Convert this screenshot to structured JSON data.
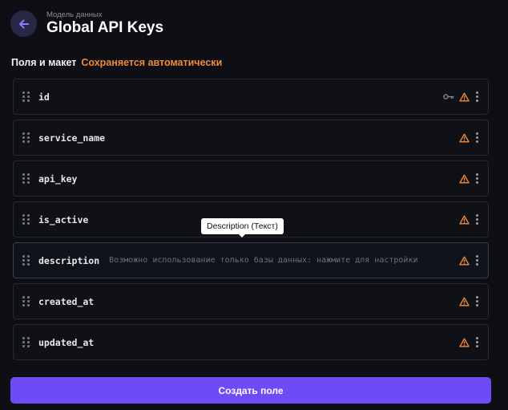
{
  "header": {
    "subtitle": "Модель данных",
    "title": "Global API Keys",
    "back_icon": "arrow-left-icon"
  },
  "section": {
    "title": "Поля и макет",
    "autosave": "Сохраняется автоматически"
  },
  "fields": [
    {
      "name": "id",
      "hint": "",
      "key": true
    },
    {
      "name": "service_name",
      "hint": "",
      "key": false
    },
    {
      "name": "api_key",
      "hint": "",
      "key": false
    },
    {
      "name": "is_active",
      "hint": "",
      "key": false
    },
    {
      "name": "description",
      "hint": "Возможно использование только базы данных: нажмите для настройки",
      "key": false
    },
    {
      "name": "created_at",
      "hint": "",
      "key": false
    },
    {
      "name": "updated_at",
      "hint": "",
      "key": false
    }
  ],
  "tooltip": "Description (Текст)",
  "create_button": "Создать поле",
  "colors": {
    "accent": "#6d4cf5",
    "warning": "#f08a3a",
    "background": "#0d0f14"
  }
}
